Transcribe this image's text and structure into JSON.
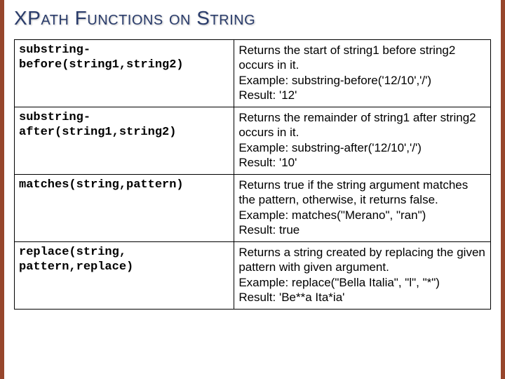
{
  "title": "XPath Functions on String",
  "rows": [
    {
      "fn": "substring-\nbefore(string1,string2)",
      "desc": "Returns the start of string1 before string2 occurs in it.\nExample: substring-before('12/10','/')\nResult: '12'"
    },
    {
      "fn": "substring-\nafter(string1,string2)",
      "desc": "Returns the remainder of string1 after string2 occurs in it.\nExample: substring-after('12/10','/')\nResult: '10'"
    },
    {
      "fn": "matches(string,pattern)",
      "desc": "Returns true if the string argument matches the pattern, otherwise, it returns false.\nExample: matches(\"Merano\", \"ran\")\nResult: true"
    },
    {
      "fn": "replace(string, pattern,replace)",
      "desc": "Returns a string created by replacing the given pattern with given argument.\nExample: replace(\"Bella Italia\", \"l\", \"*\")\nResult: 'Be**a Ita*ia'"
    }
  ]
}
